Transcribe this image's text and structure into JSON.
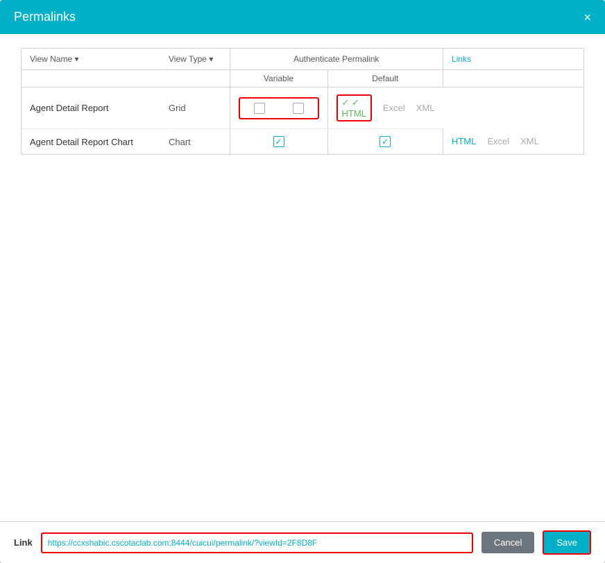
{
  "dialog": {
    "title": "Permalinks",
    "close_label": "×"
  },
  "table": {
    "headers": {
      "view_name": "View Name",
      "view_type": "View Type",
      "authenticate_permalink": "Authenticate Permalink",
      "variable": "Variable",
      "default": "Default",
      "links": "Links"
    },
    "rows": [
      {
        "view_name": "Agent Detail Report",
        "view_type": "Grid",
        "variable_checked": false,
        "default_checked": false,
        "html_active": true,
        "html_label": "HTML",
        "excel_label": "Excel",
        "xml_label": "XML",
        "html_enabled": true,
        "excel_enabled": false,
        "xml_enabled": false
      },
      {
        "view_name": "Agent Detail Report Chart",
        "view_type": "Chart",
        "variable_checked": true,
        "default_checked": true,
        "html_active": false,
        "html_label": "HTML",
        "excel_label": "Excel",
        "xml_label": "XML",
        "html_enabled": true,
        "excel_enabled": false,
        "xml_enabled": false
      }
    ]
  },
  "footer": {
    "link_label": "Link",
    "link_value": "https://ccxshabic.cscotaclab.com:8444/cuicui/permalink/?viewId=2F8D8F",
    "cancel_label": "Cancel",
    "save_label": "Save"
  }
}
